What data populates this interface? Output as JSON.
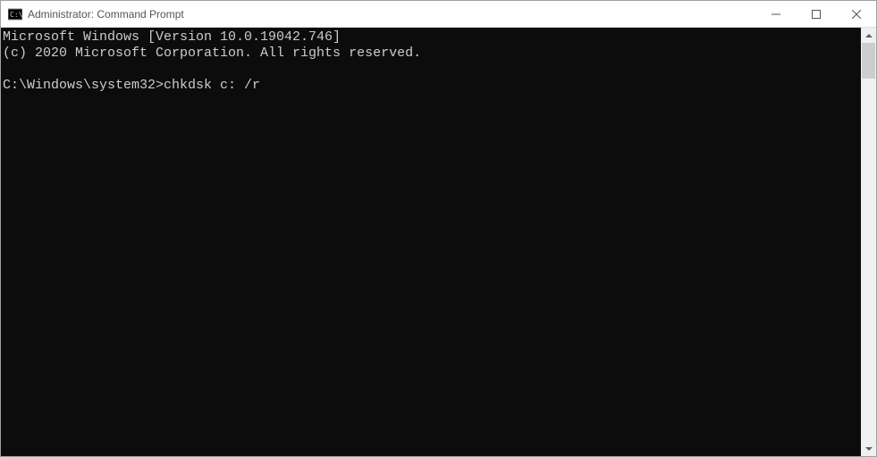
{
  "window": {
    "title": "Administrator: Command Prompt"
  },
  "terminal": {
    "lines": [
      "Microsoft Windows [Version 10.0.19042.746]",
      "(c) 2020 Microsoft Corporation. All rights reserved.",
      "",
      "C:\\Windows\\system32>chkdsk c: /r"
    ],
    "prompt": "C:\\Windows\\system32>",
    "command": "chkdsk c: /r"
  }
}
